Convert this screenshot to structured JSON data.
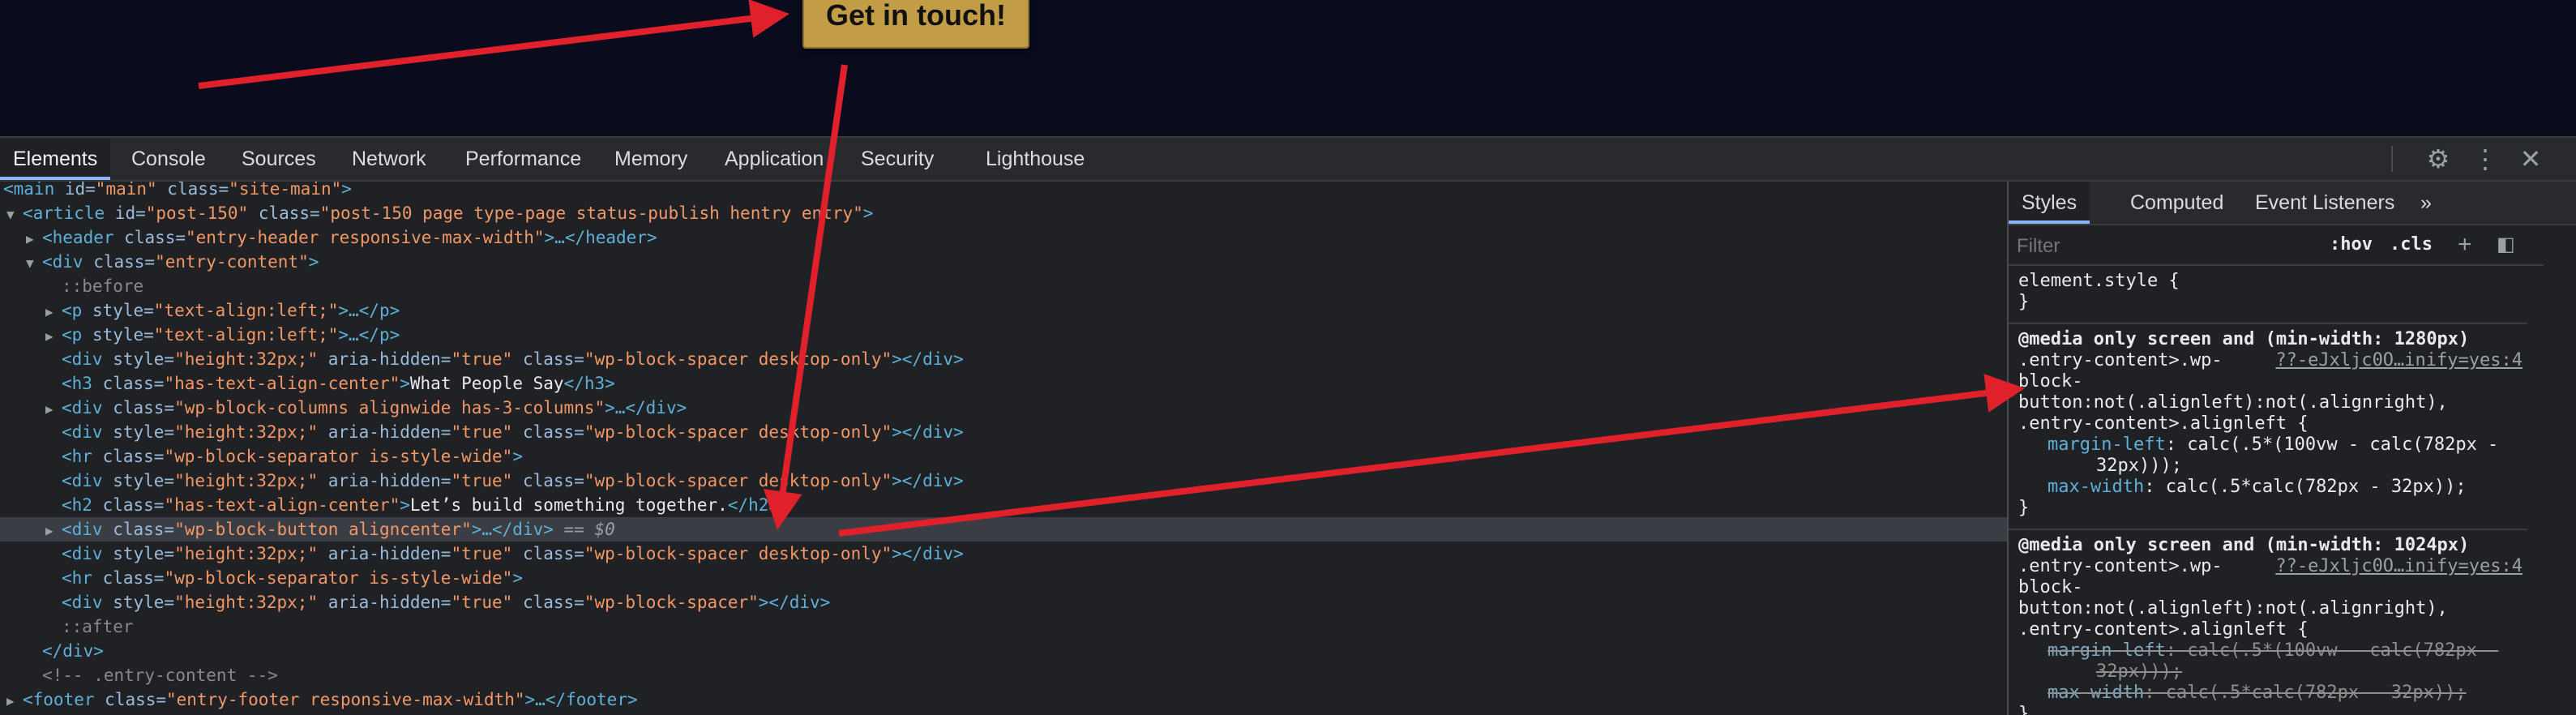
{
  "preview": {
    "cta_label": "Get in touch!"
  },
  "devtools": {
    "tabs": [
      "Elements",
      "Console",
      "Sources",
      "Network",
      "Performance",
      "Memory",
      "Application",
      "Security",
      "Lighthouse"
    ],
    "icons": {
      "settings": "gear-icon",
      "more": "kebab-icon",
      "close": "close-icon"
    }
  },
  "dom_lines": [
    {
      "tag": "<main ",
      "a1": "id=",
      "v1": "\"main\"",
      "a2": " class=",
      "v2": "\"site-main\"",
      "end": ">"
    },
    {
      "tag": "<article ",
      "a1": "id=",
      "v1": "\"post-150\"",
      "a2": " class=",
      "v2": "\"post-150 page type-page status-publish hentry entry\"",
      "end": ">"
    },
    {
      "tag": "<header ",
      "a1": "class=",
      "v1": "\"entry-header responsive-max-width\"",
      "end": ">…</header>"
    },
    {
      "tag": "<div ",
      "a1": "class=",
      "v1": "\"entry-content\"",
      "end": ">"
    },
    {
      "pseudo": "::before"
    },
    {
      "tag": "<p ",
      "a1": "style=",
      "v1": "\"text-align:left;\"",
      "end": ">…</p>"
    },
    {
      "tag": "<p ",
      "a1": "style=",
      "v1": "\"text-align:left;\"",
      "end": ">…</p>"
    },
    {
      "tag": "<div ",
      "a1": "style=",
      "v1": "\"height:32px;\"",
      "a2": " aria-hidden=",
      "v2": "\"true\"",
      "a3": " class=",
      "v3": "\"wp-block-spacer desktop-only\"",
      "end": "></div>"
    },
    {
      "tag": "<h3 ",
      "a1": "class=",
      "v1": "\"has-text-align-center\"",
      "end": ">",
      "text": "What People Say",
      "close": "</h3>"
    },
    {
      "tag": "<div ",
      "a1": "class=",
      "v1": "\"wp-block-columns alignwide has-3-columns\"",
      "end": ">…</div>"
    },
    {
      "tag": "<div ",
      "a1": "style=",
      "v1": "\"height:32px;\"",
      "a2": " aria-hidden=",
      "v2": "\"true\"",
      "a3": " class=",
      "v3": "\"wp-block-spacer desktop-only\"",
      "end": "></div>"
    },
    {
      "tag": "<hr ",
      "a1": "class=",
      "v1": "\"wp-block-separator is-style-wide\"",
      "end": ">"
    },
    {
      "tag": "<div ",
      "a1": "style=",
      "v1": "\"height:32px;\"",
      "a2": " aria-hidden=",
      "v2": "\"true\"",
      "a3": " class=",
      "v3": "\"wp-block-spacer desktop-only\"",
      "end": "></div>"
    },
    {
      "tag": "<h2 ",
      "a1": "class=",
      "v1": "\"has-text-align-center\"",
      "end": ">",
      "text": "Let’s build something together.",
      "close": "</h2>"
    },
    {
      "tag": "<div ",
      "a1": "class=",
      "v1": "\"wp-block-button aligncenter\"",
      "end": ">…</div>",
      "eq": " == $0"
    },
    {
      "tag": "<div ",
      "a1": "style=",
      "v1": "\"height:32px;\"",
      "a2": " aria-hidden=",
      "v2": "\"true\"",
      "a3": " class=",
      "v3": "\"wp-block-spacer desktop-only\"",
      "end": "></div>"
    },
    {
      "tag": "<hr ",
      "a1": "class=",
      "v1": "\"wp-block-separator is-style-wide\"",
      "end": ">"
    },
    {
      "tag": "<div ",
      "a1": "style=",
      "v1": "\"height:32px;\"",
      "a2": " aria-hidden=",
      "v2": "\"true\"",
      "a3": " class=",
      "v3": "\"wp-block-spacer\"",
      "end": "></div>"
    },
    {
      "pseudo": "::after"
    },
    {
      "tag": "</div>"
    },
    {
      "comment": "<!-- .entry-content -->"
    },
    {
      "tag": "<footer ",
      "a1": "class=",
      "v1": "\"entry-footer responsive-max-width\"",
      "end": ">…</footer>"
    }
  ],
  "styles": {
    "tabs": [
      "Styles",
      "Computed",
      "Event Listeners",
      "»"
    ],
    "filter_placeholder": "Filter",
    "hov": ":hov",
    "cls": ".cls",
    "element_style": "element.style {",
    "element_style_close": "}",
    "rule1": {
      "media": "@media only screen and (min-width: 1280px)",
      "selector_a": ".entry-content>.wp-",
      "source": "??-eJxljc0O…inify=yes:4",
      "selector_b": "block-",
      "selector_c": "button:not(.alignleft):not(.alignright),",
      "selector_d": ".entry-content>.alignleft {",
      "p1_name": "margin-left",
      "p1_val_a": ": calc(.5*(100vw - calc(782px -",
      "p1_val_b": "32px)));",
      "p2_name": "max-width",
      "p2_val": ": calc(.5*calc(782px - 32px));",
      "close": "}"
    },
    "rule2": {
      "media": "@media only screen and (min-width: 1024px)",
      "selector_a": ".entry-content>.wp-",
      "source": "??-eJxljc0O…inify=yes:4",
      "selector_b": "block-",
      "selector_c": "button:not(.alignleft):not(.alignright),",
      "selector_d": ".entry-content>.alignleft {",
      "p1_name": "margin-left",
      "p1_val_a": ": calc(.5*(100vw - calc(782px -",
      "p1_val_b": "32px)));",
      "p2_name": "max-width",
      "p2_val": ": calc(.5*calc(782px - 32px));",
      "close": "}"
    }
  },
  "colors": {
    "arrow": "#e0202a",
    "button": "#c29d45",
    "accent": "#8ab4f8"
  }
}
